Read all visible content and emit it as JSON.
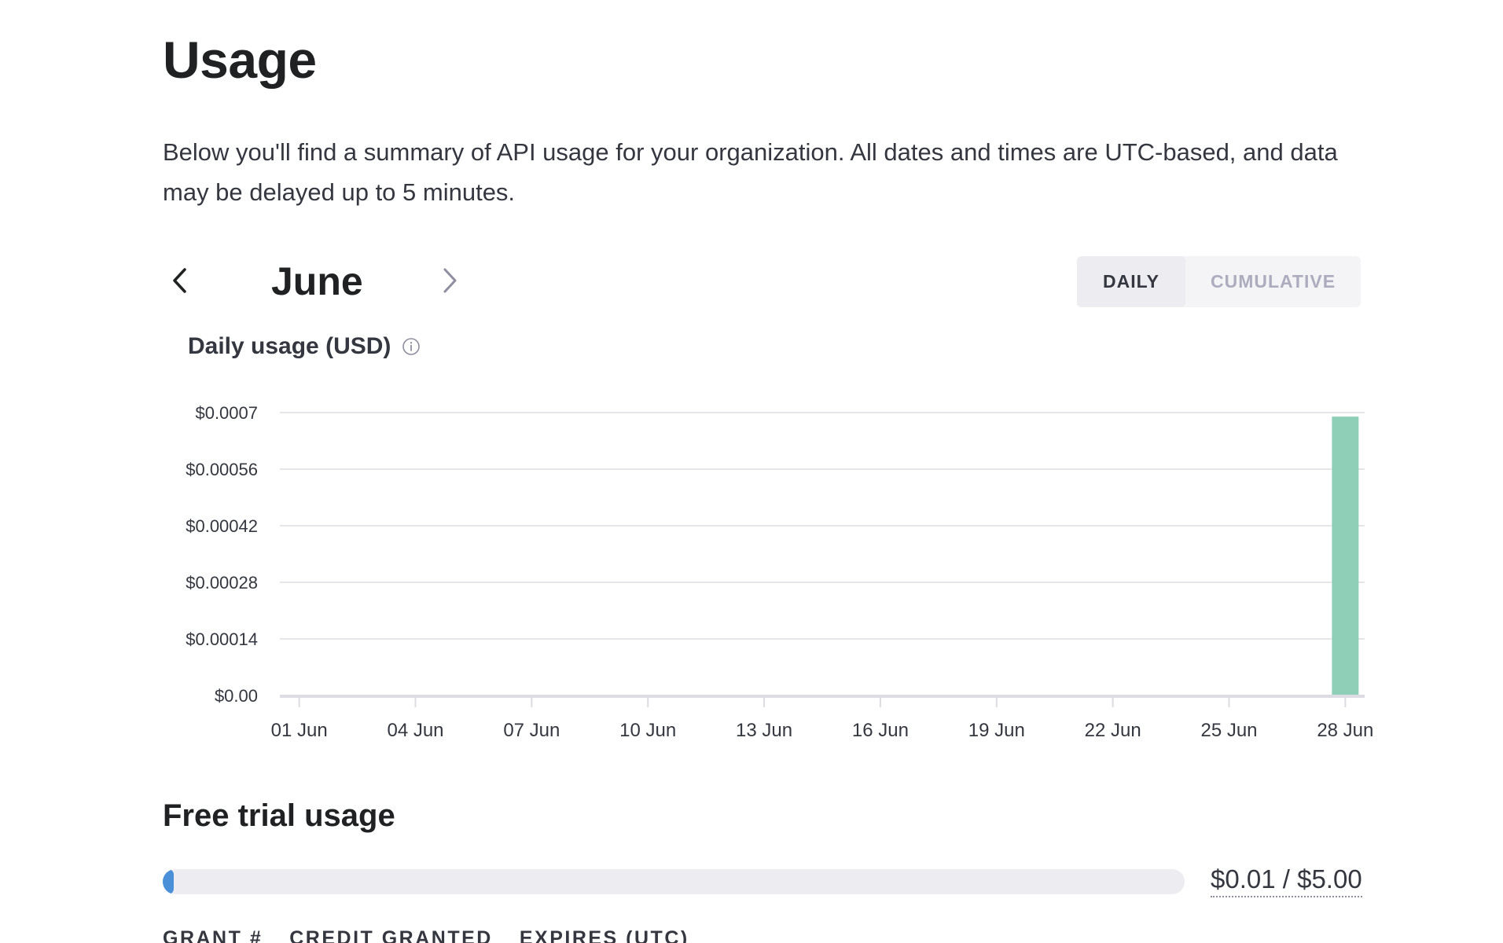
{
  "page": {
    "title": "Usage",
    "description": "Below you'll find a summary of API usage for your organization. All dates and times are UTC-based, and data may be delayed up to 5 minutes."
  },
  "month_nav": {
    "month": "June",
    "prev_icon": "chevron-left-icon",
    "next_icon": "chevron-right-icon"
  },
  "view_toggle": {
    "daily_label": "DAILY",
    "cumulative_label": "CUMULATIVE",
    "selected": "DAILY"
  },
  "chart_header": {
    "title": "Daily usage (USD)",
    "info_icon": "info-icon"
  },
  "colors": {
    "bar": "#8fcfb8",
    "progress": "#4a90d9",
    "track": "#ececf1"
  },
  "chart_data": {
    "type": "bar",
    "x": [
      "01 Jun",
      "02 Jun",
      "03 Jun",
      "04 Jun",
      "05 Jun",
      "06 Jun",
      "07 Jun",
      "08 Jun",
      "09 Jun",
      "10 Jun",
      "11 Jun",
      "12 Jun",
      "13 Jun",
      "14 Jun",
      "15 Jun",
      "16 Jun",
      "17 Jun",
      "18 Jun",
      "19 Jun",
      "20 Jun",
      "21 Jun",
      "22 Jun",
      "23 Jun",
      "24 Jun",
      "25 Jun",
      "26 Jun",
      "27 Jun",
      "28 Jun"
    ],
    "values": [
      0,
      0,
      0,
      0,
      0,
      0,
      0,
      0,
      0,
      0,
      0,
      0,
      0,
      0,
      0,
      0,
      0,
      0,
      0,
      0,
      0,
      0,
      0,
      0,
      0,
      0,
      0,
      0.00069
    ],
    "xticks": [
      "01 Jun",
      "04 Jun",
      "07 Jun",
      "10 Jun",
      "13 Jun",
      "16 Jun",
      "19 Jun",
      "22 Jun",
      "25 Jun",
      "28 Jun"
    ],
    "yticks": [
      {
        "value": 0.0007,
        "label": "$0.0007"
      },
      {
        "value": 0.00056,
        "label": "$0.00056"
      },
      {
        "value": 0.00042,
        "label": "$0.00042"
      },
      {
        "value": 0.00028,
        "label": "$0.00028"
      },
      {
        "value": 0.00014,
        "label": "$0.00014"
      },
      {
        "value": 0,
        "label": "$0.00"
      }
    ],
    "ylim": [
      0,
      0.0007
    ],
    "grid": true
  },
  "free_trial": {
    "title": "Free trial usage",
    "used": 0.01,
    "total": 5.0,
    "amount_label": "$0.01 / $5.00"
  },
  "grants_table": {
    "columns": [
      "GRANT #",
      "CREDIT GRANTED",
      "EXPIRES (UTC)"
    ]
  }
}
